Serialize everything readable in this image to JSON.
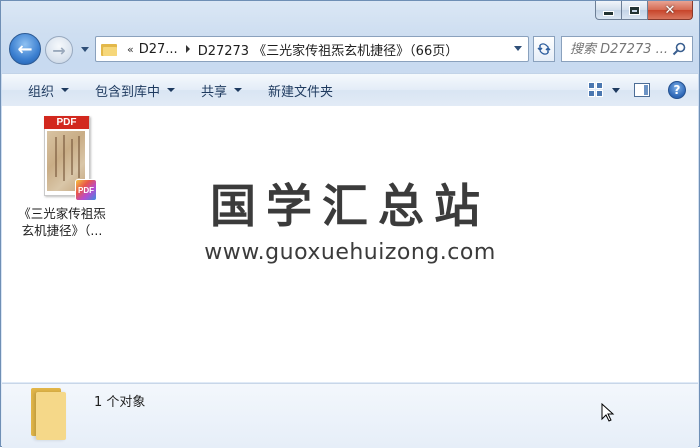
{
  "window": {
    "caption": {
      "minimize_icon": "minimize-icon",
      "maximize_icon": "maximize-icon",
      "close_icon": "close-icon",
      "close_glyph": "✕"
    }
  },
  "nav": {
    "back_icon": "back-arrow-icon",
    "forward_icon": "forward-arrow-icon",
    "overflow": "«",
    "crumbs": [
      "D27...",
      "D27273 《三光家传祖炁玄机捷径》（66页）"
    ],
    "search_placeholder": "搜索 D27273 ..."
  },
  "toolbar": {
    "organize": "组织",
    "include_in_library": "包含到库中",
    "share": "共享",
    "new_folder": "新建文件夹"
  },
  "content": {
    "files": [
      {
        "name_line1": "《三光家传祖炁",
        "name_line2": "玄机捷径》（...",
        "type_label": "PDF",
        "badge": "PDF"
      }
    ],
    "watermark_title": "国学汇总站",
    "watermark_url": "www.guoxuehuizong.com"
  },
  "details": {
    "status": "1 个对象"
  },
  "colors": {
    "accent": "#3b7fd0",
    "pdf_red": "#d2281e",
    "folder_yellow": "#f5d889"
  }
}
